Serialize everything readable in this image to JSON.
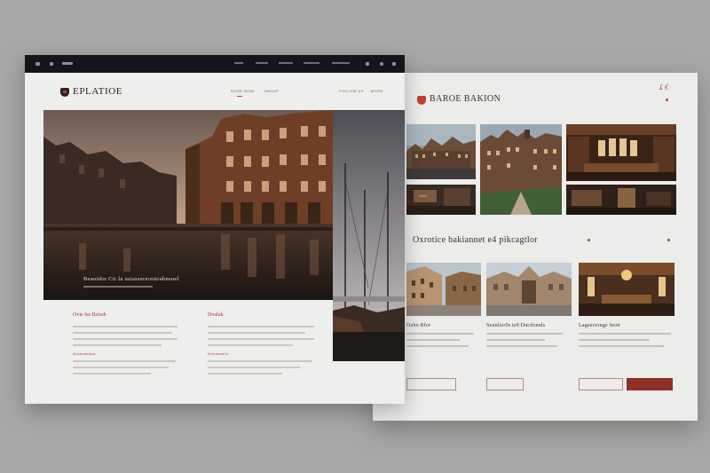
{
  "back_page": {
    "brand": "BAROE BAKION",
    "brand_sub": "",
    "nav": [
      "",
      "",
      ""
    ],
    "cta_text": "₤ €",
    "section_title": "Oxrotice bakiannet e4 pikcagtlor",
    "cards": [
      {
        "title": "Ozbo Bfor",
        "button": ""
      },
      {
        "title": "Seunlier0s te8 Ducdonnls",
        "button": ""
      },
      {
        "title": "Lagaersonge fnoir",
        "button": ""
      }
    ],
    "colors": {
      "accent": "#c0402e",
      "button_filled": "#8e3024"
    }
  },
  "front_page": {
    "brand": "EPLATIOE",
    "nav": [
      "BOOK NOW",
      "ABOUT",
      "FOLLOW US",
      "MORE"
    ],
    "hero_caption": "Beaoidor Cir la ustassereotstrabnsoel",
    "hero_button": "",
    "columns": [
      {
        "head": "Ovie fse Brisoh",
        "sub": "Ansacaudoa"
      },
      {
        "head": "Dvaluk",
        "sub": "Drenmanilu"
      }
    ],
    "colors": {
      "topbar": "#15161c",
      "accent": "#9b3d2c"
    }
  }
}
